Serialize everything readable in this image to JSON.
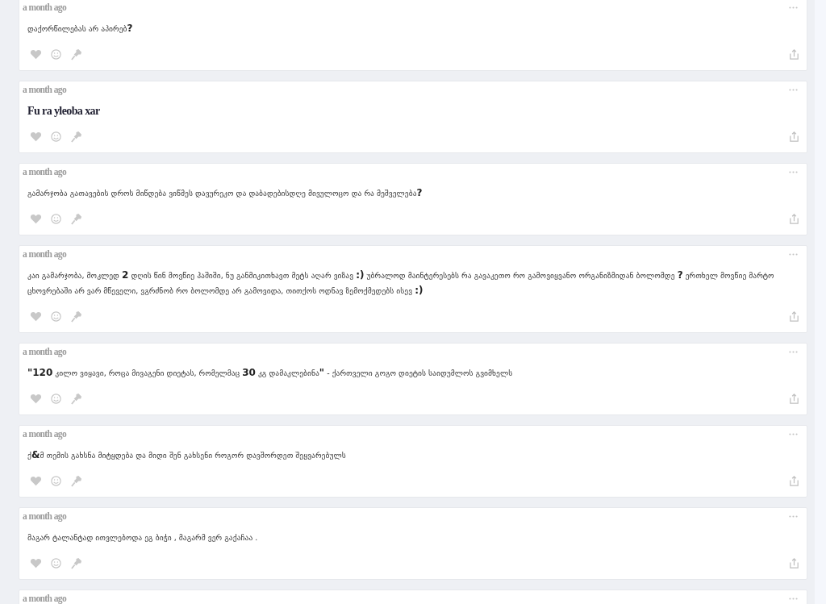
{
  "posts": [
    {
      "time": "a month ago",
      "kind": "plain",
      "text": "დაქორწილებას არ აპირებ**?**"
    },
    {
      "time": "a month ago",
      "kind": "bold",
      "text": "Fu ra yleoba xar"
    },
    {
      "time": "a month ago",
      "kind": "plain",
      "text": "გამარჯობა გათავების დროს მიწდება ვიწმეს დავურეკო და დაბადებისდღე მივულოცო და რა მეშველება**?**"
    },
    {
      "time": "a month ago",
      "kind": "plain",
      "text": "კაი გამარჯობა, მოკლედ **2** დღის წინ მოვწიე ჰაშიში, ნუ განმიკითხავთ მეტს აღარ ვიზავ **:)** უბრალოდ მაინტერესებს რა გავაკეთო რო გამოვიყვანო ორგანიზმიდან ბოლომდე **?** ერთხელ მოვწიე მარტო ცხოვრებაში არ ვარ მწეველი, ვგრძნობ რო ბოლომდე არ გამოვიდა, თითქოს ოდნავ ზემოქმედებს ისევ **:)**"
    },
    {
      "time": "a month ago",
      "kind": "plain",
      "text": "**\"120** კილო ვიყავი, როცა მივაგენი დიეტას, რომელმაც **30** კგ დამაკლებინა**\"** - ქართველი გოგო დიეტის საიდუმლოს გვიმხელს"
    },
    {
      "time": "a month ago",
      "kind": "plain",
      "text": "ქ**&**მ თემის გახსნა მიტყდება და მიდი შენ გახსენი როგორ დავშორდეთ შეყვარებულს"
    },
    {
      "time": "a month ago",
      "kind": "plain",
      "text": "მაგარ ტალანტად ითვლებოდა ეგ ბიჭი , მაგარმ ვერ გაქაჩაა ."
    },
    {
      "time": "a month ago",
      "kind": "partial"
    }
  ]
}
